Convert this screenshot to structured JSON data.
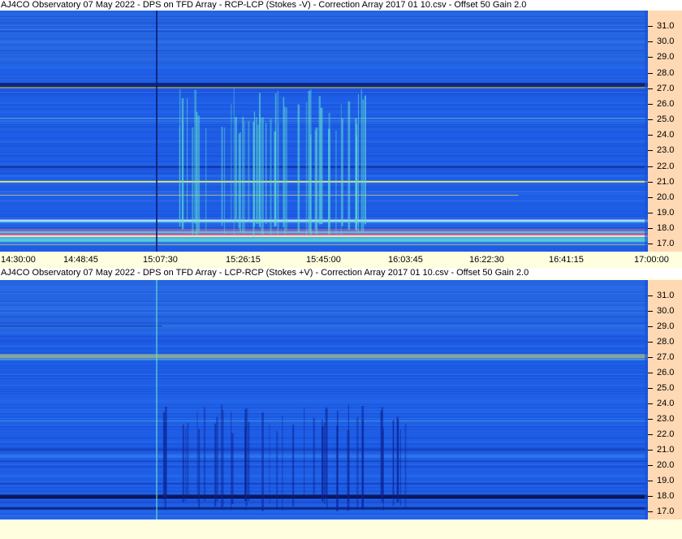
{
  "panels": [
    {
      "title": "AJ4CO Observatory 07 May 2022  -  DPS on TFD Array  -  RCP-LCP (Stokes -V)  -  Correction Array 2017 01 10.csv  -  Offset 50  Gain 2.0"
    },
    {
      "title": "AJ4CO Observatory 07 May 2022  -  DPS on TFD Array  -  LCP-RCP (Stokes +V)  -  Correction Array 2017 01 10.csv  -  Offset 50  Gain 2.0"
    }
  ],
  "colors": {
    "background": "#ffffe0",
    "axis_panel": "#ffd9b3",
    "spectrogram_base": "#1f5fe0"
  },
  "chart_data": [
    {
      "type": "heatmap",
      "title": "AJ4CO Observatory 07 May 2022  -  DPS on TFD Array  -  RCP-LCP (Stokes -V)  -  Correction Array 2017 01 10.csv  -  Offset 50  Gain 2.0",
      "x_tick_labels": [
        "14:30:00",
        "14:48:45",
        "15:07:30",
        "15:26:15",
        "15:45:00",
        "16:03:45",
        "16:22:30",
        "16:41:15",
        "17:00:00"
      ],
      "y_tick_labels": [
        "31.0",
        "30.0",
        "29.0",
        "28.0",
        "27.0",
        "26.0",
        "25.0",
        "24.0",
        "23.0",
        "22.0",
        "21.0",
        "20.0",
        "19.0",
        "18.0",
        "17.0"
      ],
      "ylim": [
        16.5,
        32.0
      ],
      "x_range": [
        "14:30:00",
        "17:00:00"
      ]
    },
    {
      "type": "heatmap",
      "title": "AJ4CO Observatory 07 May 2022  -  DPS on TFD Array  -  LCP-RCP (Stokes +V)  -  Correction Array 2017 01 10.csv  -  Offset 50  Gain 2.0",
      "y_tick_labels": [
        "31.0",
        "30.0",
        "29.0",
        "28.0",
        "27.0",
        "26.0",
        "25.0",
        "24.0",
        "23.0",
        "22.0",
        "21.0",
        "20.0",
        "19.0",
        "18.0",
        "17.0"
      ],
      "ylim": [
        16.5,
        32.0
      ],
      "x_range": [
        "14:30:00",
        "17:00:00"
      ]
    }
  ]
}
